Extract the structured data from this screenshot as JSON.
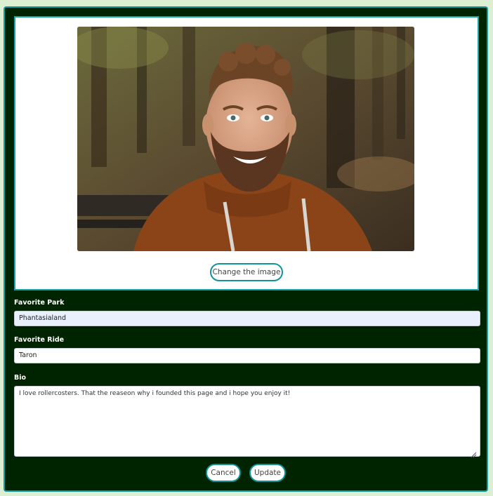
{
  "profile_image": {
    "alt": "",
    "change_label": "Change the image"
  },
  "form": {
    "favorite_park": {
      "label": "Favorite Park",
      "value": "Phantasialand"
    },
    "favorite_ride": {
      "label": "Favorite Ride",
      "value": "Taron"
    },
    "bio": {
      "label": "Bio",
      "value": "I love rollercosters. That the reaseon why i founded this page and i hope you enjoy it!"
    }
  },
  "actions": {
    "cancel_label": "Cancel",
    "update_label": "Update"
  },
  "colors": {
    "page_bg": "#dcefd2",
    "panel_bg": "#002400",
    "accent_teal": "#159ba2",
    "autofill_bg": "#e8f0fe"
  }
}
